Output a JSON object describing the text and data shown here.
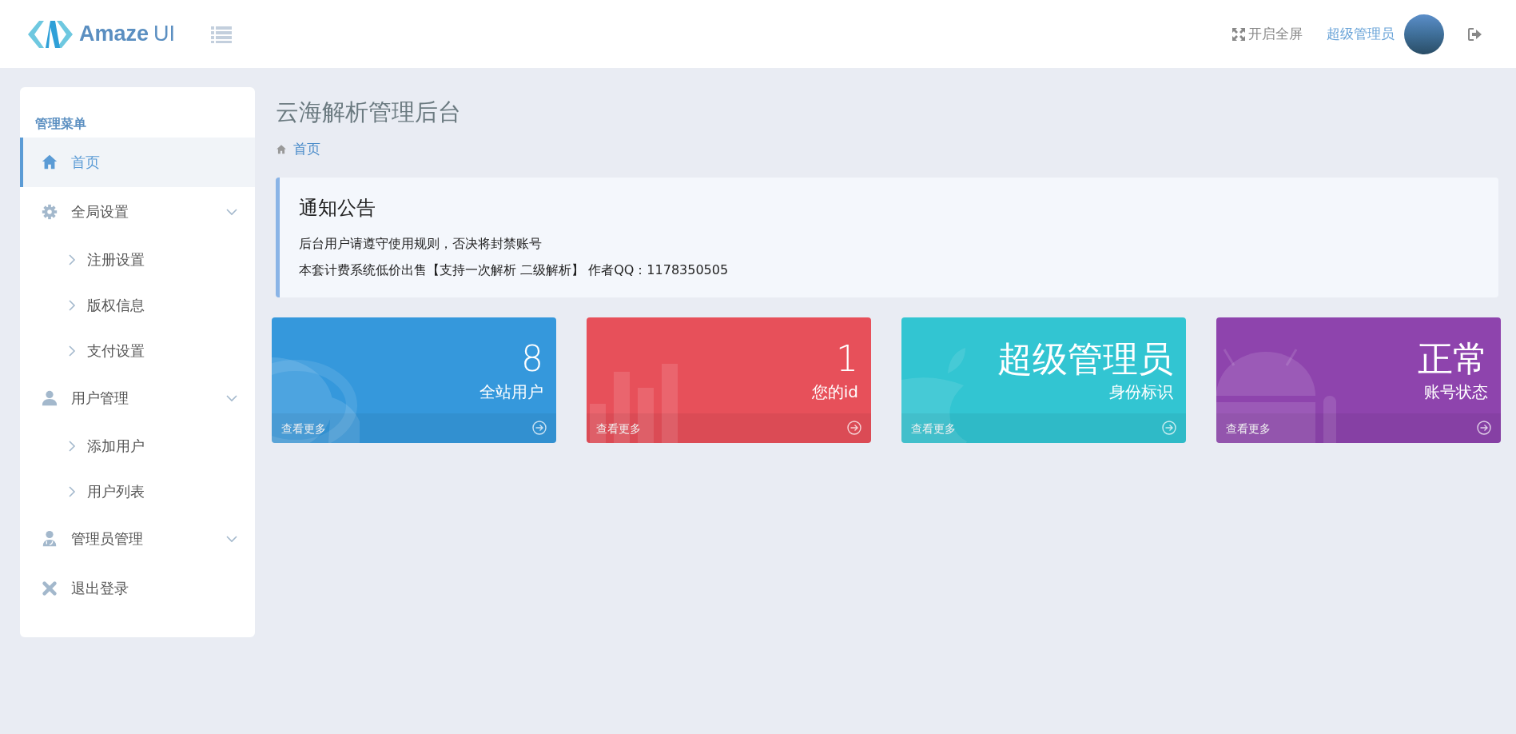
{
  "header": {
    "logo_text": "Amaze",
    "logo_suffix": "UI",
    "fullscreen": "开启全屏",
    "user_name": "超级管理员"
  },
  "sidebar": {
    "title": "管理菜单",
    "items": [
      {
        "label": "首页",
        "selected": true
      },
      {
        "label": "全局设置",
        "selected": false,
        "expanded": true,
        "children": [
          {
            "label": "注册设置"
          },
          {
            "label": "版权信息"
          },
          {
            "label": "支付设置"
          }
        ]
      },
      {
        "label": "用户管理",
        "selected": false,
        "expanded": true,
        "children": [
          {
            "label": "添加用户"
          },
          {
            "label": "用户列表"
          }
        ]
      },
      {
        "label": "管理员管理",
        "selected": false,
        "expanded": true
      },
      {
        "label": "退出登录",
        "selected": false
      }
    ]
  },
  "page": {
    "title": "云海解析管理后台",
    "breadcrumb": "首页"
  },
  "notice": {
    "title": "通知公告",
    "lines": [
      "后台用户请遵守使用规则，否决将封禁账号",
      "本套计费系统低价出售【支持一次解析 二级解析】 作者QQ：1178350505"
    ]
  },
  "cards": [
    {
      "value": "8",
      "label": "全站用户",
      "more": "查看更多",
      "color": "#3598dc"
    },
    {
      "value": "1",
      "label": "您的id",
      "more": "查看更多",
      "color": "#e7505a"
    },
    {
      "value": "超级管理员",
      "label": "身份标识",
      "more": "查看更多",
      "color": "#32c5d2"
    },
    {
      "value": "正常",
      "label": "账号状态",
      "more": "查看更多",
      "color": "#8e44ad"
    }
  ]
}
